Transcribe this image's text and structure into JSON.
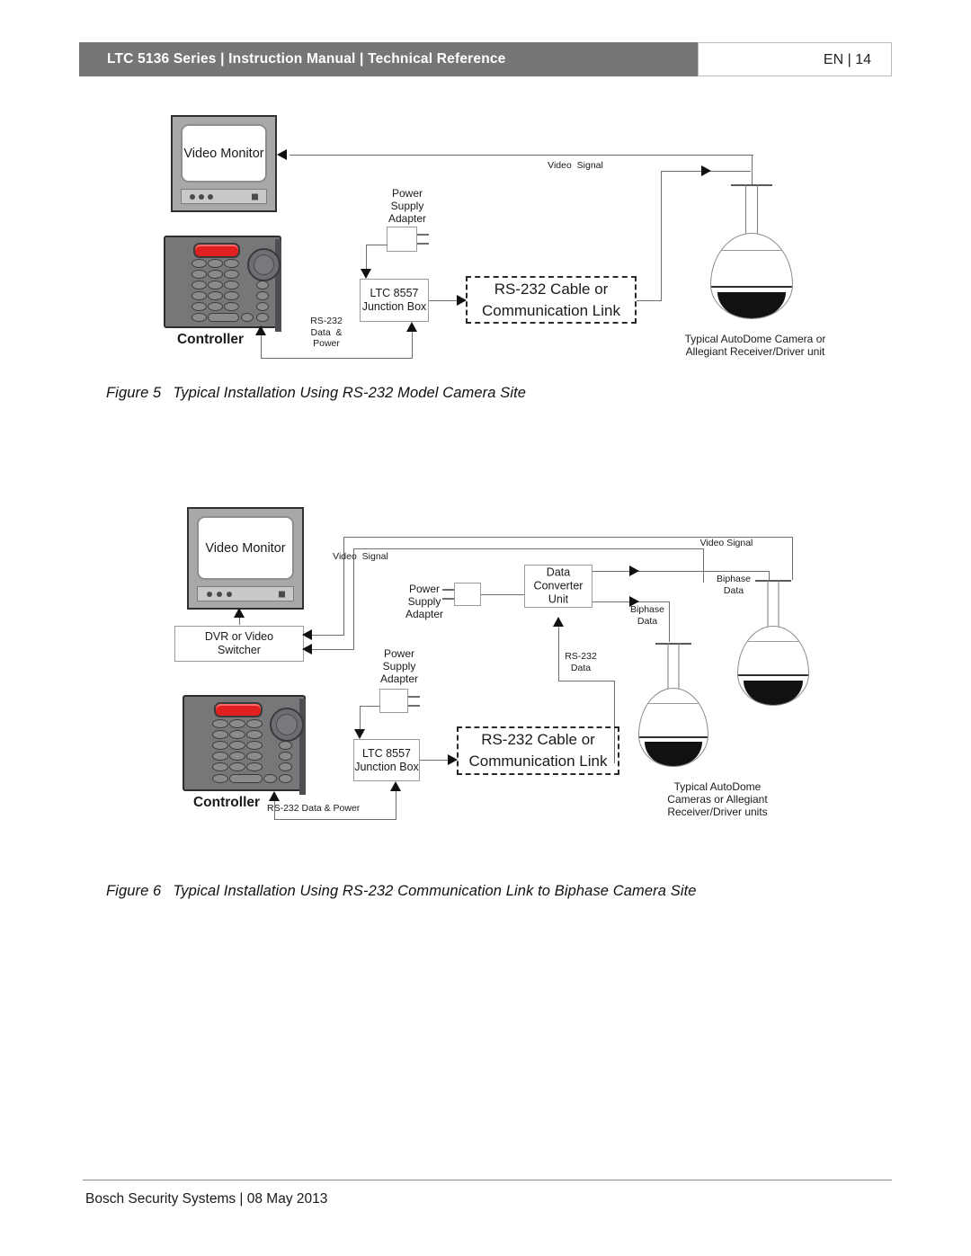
{
  "header": {
    "title": "LTC 5136 Series | Instruction Manual | Technical Reference",
    "page_label": "EN | 14",
    "bar_color": "#767676"
  },
  "footer": {
    "text": "Bosch Security Systems | 08 May 2013"
  },
  "figure5": {
    "caption_number": "Figure 5",
    "caption_text": "Typical Installation Using RS-232 Model Camera Site",
    "monitor_label": "Video Monitor",
    "controller_label": "Controller",
    "psu_label": "Power\nSupply\nAdapter",
    "junction_box_label": "LTC 8557\nJunction Box",
    "comm_link_label": "RS-232 Cable or\nCommunication Link",
    "video_signal_label": "Video  Signal",
    "rs232_data_power_label": "RS-232\nData  &\nPower",
    "camera_caption": "Typical AutoDome Camera or\nAllegiant Receiver/Driver unit"
  },
  "figure6": {
    "caption_number": "Figure 6",
    "caption_text": "Typical Installation Using RS-232 Communication Link to Biphase Camera Site",
    "monitor_label": "Video Monitor",
    "dvr_label": "DVR or Video\nSwitcher",
    "controller_label": "Controller",
    "psu_label_top": "Power\nSupply\nAdapter",
    "psu_label_bottom": "Power\nSupply\nAdapter",
    "junction_box_label": "LTC 8557\nJunction Box",
    "comm_link_label": "RS-232 Cable or\nCommunication Link",
    "data_converter_label": "Data\nConverter\nUnit",
    "video_signal_label_left": "Video  Signal",
    "video_signal_label_right": "Video Signal",
    "biphase_data_label_left": "Biphase\nData",
    "biphase_data_label_right": "Biphase\nData",
    "rs232_data_label": "RS-232\nData",
    "rs232_data_power_label": "RS-232 Data & Power",
    "camera_caption": "Typical AutoDome\nCameras or Allegiant\nReceiver/Driver units"
  }
}
